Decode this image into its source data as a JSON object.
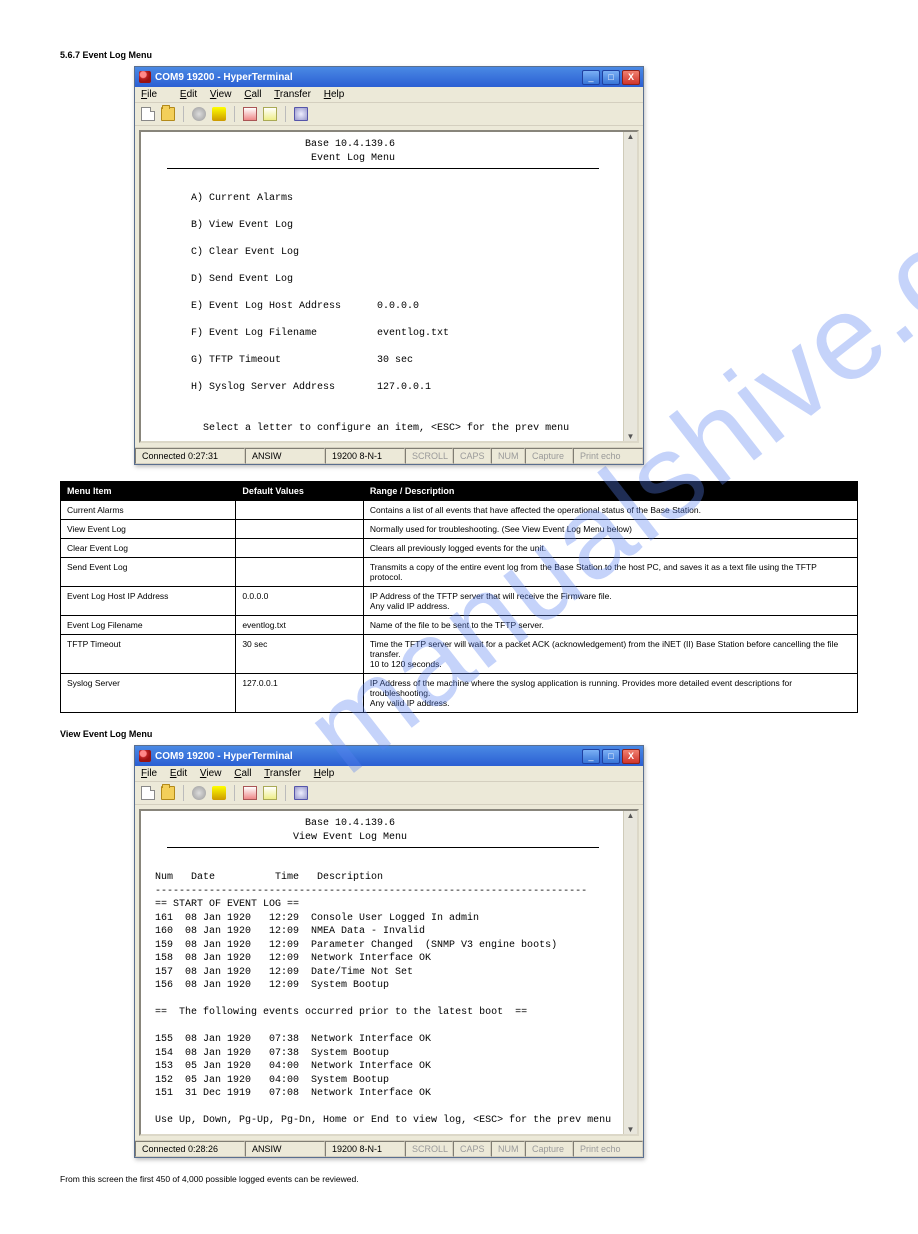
{
  "page": {
    "title": "5.6.7 Event Log Menu"
  },
  "win1": {
    "title": "COM9 19200 - HyperTerminal",
    "menus": {
      "file": "File",
      "edit": "Edit",
      "view": "View",
      "call": "Call",
      "transfer": "Transfer",
      "help": "Help"
    },
    "term": {
      "header1": "Base 10.4.139.6",
      "header2": "Event Log Menu",
      "items": [
        "A) Current Alarms",
        "B) View Event Log",
        "C) Clear Event Log",
        "D) Send Event Log",
        "E) Event Log Host Address      0.0.0.0",
        "F) Event Log Filename          eventlog.txt",
        "G) TFTP Timeout                30 sec",
        "H) Syslog Server Address       127.0.0.1"
      ],
      "prompt": "Select a letter to configure an item, <ESC> for the prev menu"
    },
    "status": {
      "conn": "Connected 0:27:31",
      "emu": "ANSIW",
      "port": "19200 8-N-1",
      "scroll": "SCROLL",
      "caps": "CAPS",
      "num": "NUM",
      "capture": "Capture",
      "echo": "Print echo"
    }
  },
  "table": {
    "headers": [
      "Menu Item",
      "Default Values",
      "Range / Description"
    ],
    "rows": [
      [
        "Current Alarms",
        "",
        "Contains a list of all events that have affected the operational status of the Base Station."
      ],
      [
        "View Event Log",
        "",
        "Normally used for troubleshooting. (See View Event Log Menu below)"
      ],
      [
        "Clear Event Log",
        "",
        "Clears all previously logged events for the unit."
      ],
      [
        "Send Event Log",
        "",
        "Transmits a copy of the entire event log from the Base Station to the host PC, and saves it as a text file using the TFTP protocol."
      ],
      [
        "Event Log Host IP Address",
        "0.0.0.0",
        "IP Address of the TFTP server that will receive the Firmware file.\nAny valid IP address."
      ],
      [
        "Event Log Filename",
        "eventlog.txt",
        "Name of the file to be sent to the TFTP server."
      ],
      [
        "TFTP Timeout",
        "30 sec",
        "Time the TFTP server will wait for a packet ACK (acknowledgement) from the iNET (II) Base Station before cancelling the file transfer.\n10 to 120 seconds."
      ],
      [
        "Syslog Server",
        "127.0.0.1",
        "IP Address of the machine where the syslog application is running. Provides more detailed event descriptions for troubleshooting.\nAny valid IP address."
      ]
    ]
  },
  "section2": {
    "heading": "View Event Log Menu"
  },
  "win2": {
    "title": "COM9 19200 - HyperTerminal",
    "menus": {
      "file": "File",
      "edit": "Edit",
      "view": "View",
      "call": "Call",
      "transfer": "Transfer",
      "help": "Help"
    },
    "term": {
      "header1": "Base 10.4.139.6",
      "header2": "View Event Log Menu",
      "cols": "Num   Date          Time   Description",
      "start": "== START OF EVENT LOG ==",
      "rows": [
        " 161  08 Jan 1920   12:29  Console User Logged In admin",
        " 160  08 Jan 1920   12:09  NMEA Data - Invalid",
        " 159  08 Jan 1920   12:09  Parameter Changed  (SNMP V3 engine boots)",
        " 158  08 Jan 1920   12:09  Network Interface OK",
        " 157  08 Jan 1920   12:09  Date/Time Not Set",
        " 156  08 Jan 1920   12:09  System Bootup"
      ],
      "prior": "==  The following events occurred prior to the latest boot  ==",
      "rows2": [
        " 155  08 Jan 1920   07:38  Network Interface OK",
        " 154  08 Jan 1920   07:38  System Bootup",
        " 153  05 Jan 1920   04:00  Network Interface OK",
        " 152  05 Jan 1920   04:00  System Bootup",
        " 151  31 Dec 1919   07:08  Network Interface OK"
      ],
      "prompt": "Use Up, Down, Pg-Up, Pg-Dn, Home or End to view log, <ESC> for the prev menu"
    },
    "status": {
      "conn": "Connected 0:28:26",
      "emu": "ANSIW",
      "port": "19200 8-N-1",
      "scroll": "SCROLL",
      "caps": "CAPS",
      "num": "NUM",
      "capture": "Capture",
      "echo": "Print echo"
    }
  },
  "footer_note": "From this screen the first 450 of 4,000 possible logged events can be reviewed."
}
